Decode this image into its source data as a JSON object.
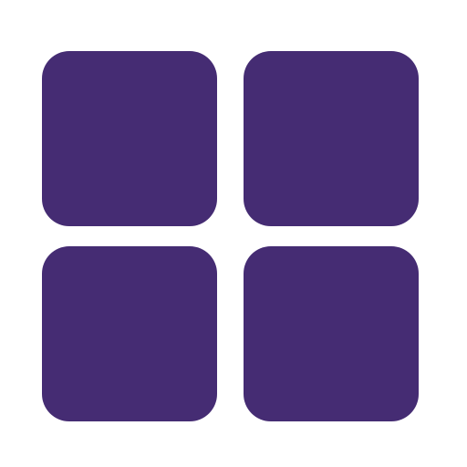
{
  "icon": {
    "name": "grid-icon",
    "tiles": [
      {
        "name": "tile-top-left"
      },
      {
        "name": "tile-top-right"
      },
      {
        "name": "tile-bottom-left"
      },
      {
        "name": "tile-bottom-right"
      }
    ]
  },
  "colors": {
    "tile": "#452c73",
    "background": "#ffffff"
  }
}
